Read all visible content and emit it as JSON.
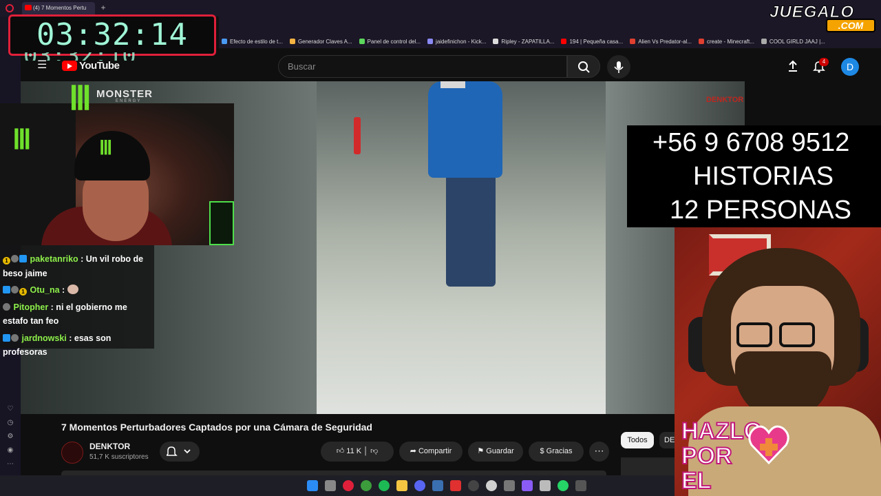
{
  "browser": {
    "tab_title": "(4) 7 Momentos Pertu",
    "bookmarks": [
      {
        "label": "Efecto de estilo de t...",
        "color": "#4a9af5"
      },
      {
        "label": "Generador Claves A...",
        "color": "#f5b342"
      },
      {
        "label": "Panel de control del...",
        "color": "#5cd65c"
      },
      {
        "label": "jaidefinichon - Kick...",
        "color": "#8a8af5"
      },
      {
        "label": "Ripley - ZAPATILLA...",
        "color": "#dddddd"
      },
      {
        "label": "194 | Pequeña casa...",
        "color": "#ff0000"
      },
      {
        "label": "Alien Vs Predator-al...",
        "color": "#e04030"
      },
      {
        "label": "create - Minecraft...",
        "color": "#e04030"
      },
      {
        "label": "COOL GIRLD JAAJ |...",
        "color": "#aaaaaa"
      }
    ]
  },
  "youtube": {
    "wordmark": "YouTube",
    "search_placeholder": "Buscar",
    "notification_count": "4",
    "avatar_letter": "D"
  },
  "video": {
    "title": "7 Momentos Perturbadores Captados por una Cámara de Seguridad",
    "channel_logo_text": "DENKTOR",
    "channel": "DENKTOR",
    "subscribers": "51,7 K suscriptores",
    "likes": "11 K",
    "share": "Compartir",
    "save": "Guardar",
    "thanks": "Gracias",
    "more": "⋯"
  },
  "chips": {
    "all": "Todos",
    "next": "DE"
  },
  "overlay": {
    "timer": "03:32:14",
    "monster_word": "MONSTER",
    "monster_sub": "ENERGY",
    "info_lines": [
      "+56 9 6708 9512",
      "HISTORIAS",
      "12 PERSONAS"
    ],
    "juegalo": "JUEGALO",
    "juegalo_com": ".COM",
    "hazlo_lines": [
      "HAZLO",
      "POR",
      "EL"
    ]
  },
  "chat": [
    {
      "user": "paketanriko",
      "text": ": Un vil robo de beso jaime"
    },
    {
      "user": "Otu_na",
      "text": ":"
    },
    {
      "user": "Pitopher",
      "text": ": ni el gobierno me estafo tan feo"
    },
    {
      "user": "jardnowski",
      "text": ": esas son profesoras"
    }
  ]
}
